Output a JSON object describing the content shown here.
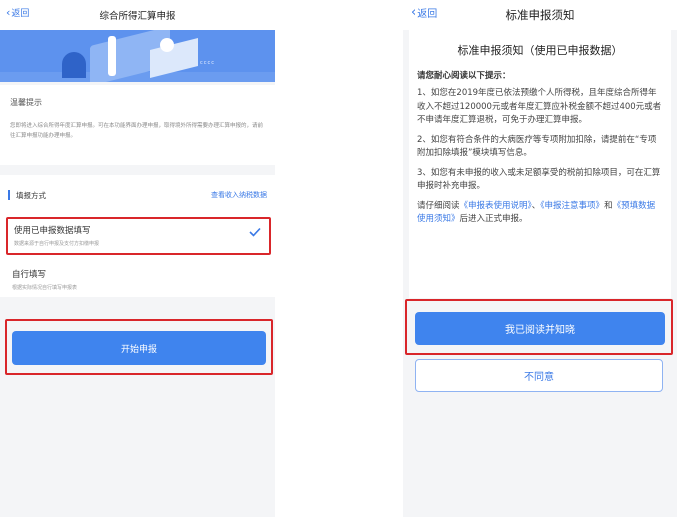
{
  "left": {
    "nav": {
      "back": "返回",
      "title": "综合所得汇算申报"
    },
    "banner": {
      "decor_text": "cccc"
    },
    "tip": {
      "title": "温馨提示",
      "body": "您即将进入综合所得年度汇算申报。可在本功能界面办理申报，取得境外所得需要办理汇算申报的，请前往汇算申报功能办理申报。"
    },
    "fill": {
      "label": "填报方式",
      "link": "查看收入纳税数据",
      "option1": {
        "title": "使用已申报数据填写",
        "subtitle": "数据来源于自行申报及支付方扣缴申报"
      },
      "option2": {
        "title": "自行填写",
        "subtitle": "根据实际情况自行填写申报表"
      }
    },
    "start_button": "开始申报"
  },
  "right": {
    "nav": {
      "back": "返回",
      "title": "标准申报须知"
    },
    "notice": {
      "title": "标准申报须知（使用已申报数据）",
      "hint": "请您耐心阅读以下提示：",
      "p1": "1、如您在2019年度已依法预缴个人所得税，且年度综合所得年收入不超过120000元或者年度汇算应补税金额不超过400元或者不申请年度汇算退税，可免于办理汇算申报。",
      "p2": "2、如您有符合条件的大病医疗等专项附加扣除，请提前在“专项附加扣除填报”模块填写信息。",
      "p3": "3、如您有未申报的收入或未足额享受的税前扣除项目，可在汇算申报时补充申报。",
      "read_prefix": "请仔细阅读",
      "link1": "《申报表使用说明》",
      "sep1": "、",
      "link2": "《申报注意事项》",
      "and": "和",
      "link3": "《预填数据使用须知》",
      "read_suffix": "后进入正式申报。"
    },
    "agree_button": "我已阅读并知晓",
    "disagree_button": "不同意"
  },
  "colors": {
    "accent": "#3f84ee",
    "highlight_border": "#d9262a",
    "link": "#3a79e6"
  }
}
